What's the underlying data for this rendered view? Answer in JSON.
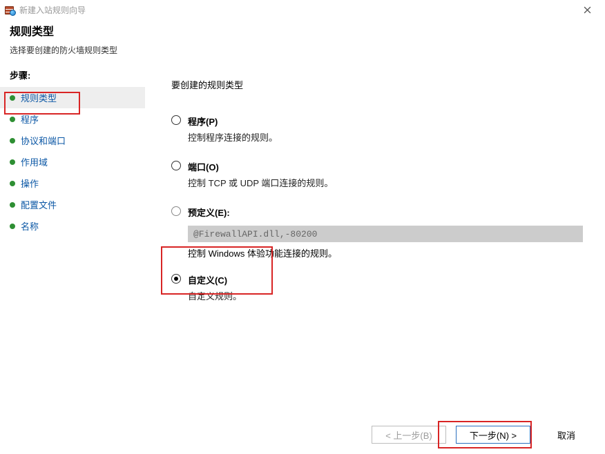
{
  "window": {
    "title": "新建入站规则向导"
  },
  "header": {
    "title": "规则类型",
    "subtitle": "选择要创建的防火墙规则类型"
  },
  "sidebar": {
    "steps_label": "步骤:",
    "items": [
      {
        "label": "规则类型",
        "current": true
      },
      {
        "label": "程序"
      },
      {
        "label": "协议和端口"
      },
      {
        "label": "作用域"
      },
      {
        "label": "操作"
      },
      {
        "label": "配置文件"
      },
      {
        "label": "名称"
      }
    ]
  },
  "content": {
    "prompt": "要创建的规则类型",
    "options": {
      "program": {
        "title": "程序(P)",
        "desc": "控制程序连接的规则。"
      },
      "port": {
        "title": "端口(O)",
        "desc": "控制 TCP 或 UDP 端口连接的规则。"
      },
      "predefined": {
        "title": "预定义(E):",
        "select_value": "@FirewallAPI.dll,-80200",
        "desc": "控制 Windows 体验功能连接的规则。"
      },
      "custom": {
        "title": "自定义(C)",
        "desc": "自定义规则。"
      }
    },
    "selected": "custom"
  },
  "buttons": {
    "back": "< 上一步(B)",
    "next": "下一步(N) >",
    "cancel": "取消"
  }
}
